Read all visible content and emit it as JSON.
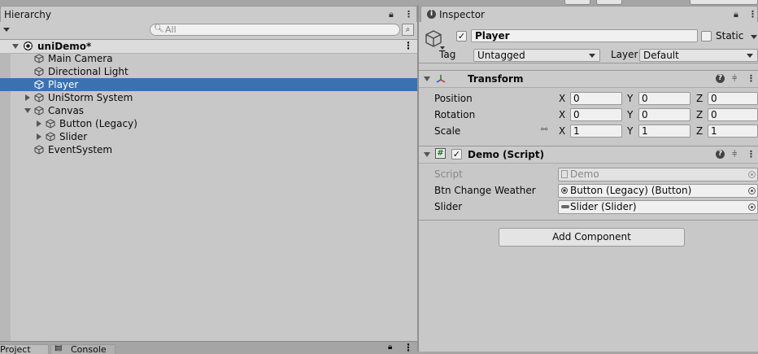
{
  "hierarchy": {
    "tab_label": "Hierarchy",
    "search_placeholder": "All",
    "scene_name": "uniDemo*",
    "items": [
      {
        "label": "Main Camera"
      },
      {
        "label": "Directional Light"
      },
      {
        "label": "Player"
      },
      {
        "label": "UniStorm System"
      },
      {
        "label": "Canvas"
      },
      {
        "label": "Button (Legacy)"
      },
      {
        "label": "Slider"
      },
      {
        "label": "EventSystem"
      }
    ]
  },
  "bottom_tabs": {
    "project": "Project",
    "console": "Console"
  },
  "inspector": {
    "tab_label": "Inspector",
    "object_name": "Player",
    "static_label": "Static",
    "tag_label": "Tag",
    "tag_value": "Untagged",
    "layer_label": "Layer",
    "layer_value": "Default",
    "transform": {
      "title": "Transform",
      "rows": [
        {
          "label": "Position",
          "x": "0",
          "y": "0",
          "z": "0"
        },
        {
          "label": "Rotation",
          "x": "0",
          "y": "0",
          "z": "0"
        },
        {
          "label": "Scale",
          "x": "1",
          "y": "1",
          "z": "1"
        }
      ],
      "axes": {
        "x": "X",
        "y": "Y",
        "z": "Z"
      }
    },
    "script": {
      "title": "Demo (Script)",
      "hash": "#",
      "fields": [
        {
          "label": "Script",
          "value": "Demo"
        },
        {
          "label": "Btn Change Weather",
          "value": "Button (Legacy) (Button)"
        },
        {
          "label": "Slider",
          "value": "Slider (Slider)"
        }
      ]
    },
    "add_component": "Add Component"
  }
}
